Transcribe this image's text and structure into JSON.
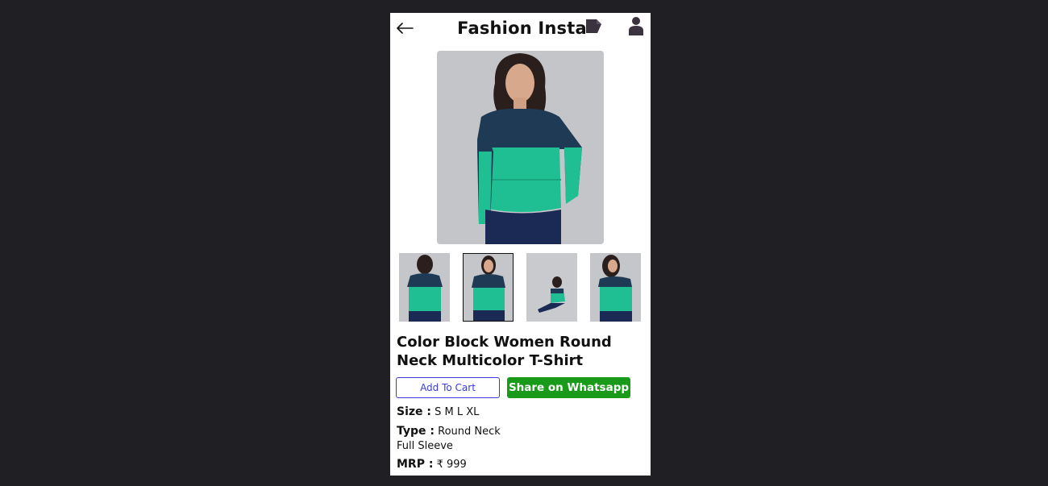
{
  "header": {
    "title": "Fashion Insta",
    "back_icon": "back-arrow-icon",
    "cart_icon": "cart-tag-icon",
    "profile_icon": "user-icon"
  },
  "product": {
    "title": "Color Block Women Round Neck Multicolor T-Shirt",
    "thumbnails": [
      {
        "view": "back"
      },
      {
        "view": "front",
        "selected": true
      },
      {
        "view": "seated"
      },
      {
        "view": "side"
      }
    ]
  },
  "actions": {
    "add_to_cart": "Add To Cart",
    "share_whatsapp": "Share on Whatsapp"
  },
  "specs": {
    "size_label": "Size :",
    "size_value": "S M L XL",
    "type_label": "Type :",
    "type_value": "Round Neck",
    "type_value2": "Full Sleeve",
    "mrp_label": "MRP :",
    "mrp_value": "₹ 999"
  },
  "colors": {
    "background": "#202024",
    "panel": "#ffffff",
    "add_to_cart_border": "#3b3bdc",
    "whatsapp_green": "#1a9a1a",
    "shirt_navy": "#1f3a55",
    "shirt_teal": "#1fbf93"
  }
}
